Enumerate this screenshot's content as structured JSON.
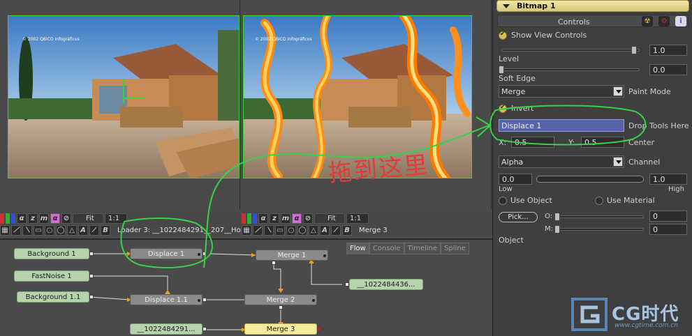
{
  "viewers": {
    "left": {
      "copyright": "© 2002 QBICO Infográficos",
      "fit_label": "Fit",
      "scale_label": "1:1",
      "label": "Loader 3: __1022484291__207__Ho"
    },
    "right": {
      "copyright": "© 2002 QBICO Infográficos",
      "fit_label": "Fit",
      "scale_label": "1:1",
      "label": "Merge 3"
    },
    "toolbar_glyphs": {
      "alpha": "α",
      "z": "z",
      "m": "m",
      "a": "A",
      "b": "B"
    }
  },
  "annotation": {
    "handwritten_text": "拖到这里"
  },
  "flow": {
    "tabs": [
      "Flow",
      "Console",
      "Timeline",
      "Spline"
    ],
    "active_tab": "Flow",
    "nodes": {
      "background1": "Background 1",
      "fastnoise1": "FastNoise 1",
      "background11": "Background 1.1",
      "loader_a": "__1022484291...",
      "displace1": "Displace 1",
      "displace11": "Displace 1.1",
      "merge1": "Merge 1",
      "merge2": "Merge 2",
      "merge3": "Merge 3",
      "loader_b": "__1022484436..."
    }
  },
  "panel": {
    "tool_name": "Bitmap 1",
    "controls_label": "Controls",
    "show_view_controls": "Show View Controls",
    "level": {
      "label": "Level",
      "value": "1.0",
      "fraction": 0.96
    },
    "soft_edge": {
      "label": "Soft Edge",
      "value": "0.0",
      "fraction": 0.0
    },
    "paint_mode": {
      "value": "Merge",
      "label": "Paint Mode"
    },
    "invert": "Invert",
    "drop_tool": {
      "value": "Displace 1",
      "label": "Drop Tools Here"
    },
    "center": {
      "x_label": "X:",
      "x_value": "0.5",
      "y_label": "Y:",
      "y_value": "0.5",
      "label": "Center"
    },
    "channel": {
      "value": "Alpha",
      "label": "Channel"
    },
    "low_high": {
      "low_value": "0.0",
      "high_value": "1.0",
      "low_label": "Low",
      "high_label": "High"
    },
    "use_object": "Use Object",
    "use_material": "Use Material",
    "pick_label": "Pick...",
    "o_label": "O:",
    "o_value": "0",
    "m_label": "M:",
    "m_value": "0",
    "object_label": "Object",
    "watermark": {
      "text": "CG时代",
      "url": "www.cgtime.com.cn"
    },
    "icon_colors": {
      "radiation": "#e8c040",
      "gear": "#c03030",
      "info": "#5050c0"
    }
  }
}
